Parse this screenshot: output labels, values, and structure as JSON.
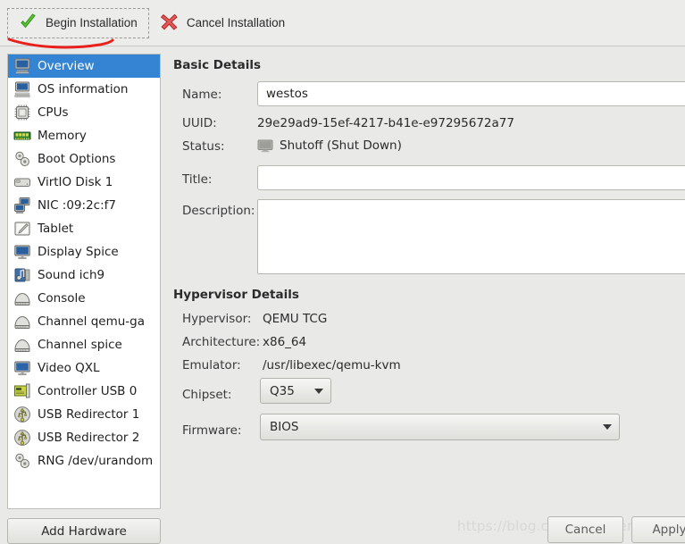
{
  "window": {
    "background_color": "#e9e9e7",
    "accent_color": "#3584d4"
  },
  "toolbar": {
    "begin_label": "Begin Installation",
    "begin_icon": "green-check-icon",
    "cancel_label": "Cancel Installation",
    "cancel_icon": "red-x-icon"
  },
  "sidebar": {
    "items": [
      {
        "label": "Overview",
        "icon": "monitor-icon",
        "selected": true
      },
      {
        "label": "OS information",
        "icon": "computer-icon",
        "selected": false
      },
      {
        "label": "CPUs",
        "icon": "cpu-chip-icon",
        "selected": false
      },
      {
        "label": "Memory",
        "icon": "memory-ram-icon",
        "selected": false
      },
      {
        "label": "Boot Options",
        "icon": "gears-icon",
        "selected": false
      },
      {
        "label": "VirtIO Disk 1",
        "icon": "hard-disk-icon",
        "selected": false
      },
      {
        "label": "NIC :09:2c:f7",
        "icon": "network-card-icon",
        "selected": false
      },
      {
        "label": "Tablet",
        "icon": "tablet-pen-icon",
        "selected": false
      },
      {
        "label": "Display Spice",
        "icon": "display-icon",
        "selected": false
      },
      {
        "label": "Sound ich9",
        "icon": "sound-icon",
        "selected": false
      },
      {
        "label": "Console",
        "icon": "console-icon",
        "selected": false
      },
      {
        "label": "Channel qemu-ga",
        "icon": "console-icon",
        "selected": false
      },
      {
        "label": "Channel spice",
        "icon": "console-icon",
        "selected": false
      },
      {
        "label": "Video QXL",
        "icon": "video-icon",
        "selected": false
      },
      {
        "label": "Controller USB 0",
        "icon": "controller-icon",
        "selected": false
      },
      {
        "label": "USB Redirector 1",
        "icon": "usb-icon",
        "selected": false
      },
      {
        "label": "USB Redirector 2",
        "icon": "usb-icon",
        "selected": false
      },
      {
        "label": "RNG /dev/urandom",
        "icon": "gears-icon",
        "selected": false
      }
    ],
    "add_hardware_label": "Add Hardware"
  },
  "basic_details": {
    "title": "Basic Details",
    "name_label": "Name:",
    "name_value": "westos",
    "name_placeholder": "",
    "uuid_label": "UUID:",
    "uuid_value": "29e29ad9-15ef-4217-b41e-e97295672a77",
    "status_label": "Status:",
    "status_value": "Shutoff (Shut Down)",
    "status_icon": "shutoff-monitor-icon",
    "title_label": "Title:",
    "title_value": "",
    "title_placeholder": "",
    "description_label": "Description:",
    "description_value": "",
    "description_placeholder": ""
  },
  "hypervisor_details": {
    "title": "Hypervisor Details",
    "hypervisor_label": "Hypervisor:",
    "hypervisor_value": "QEMU TCG",
    "architecture_label": "Architecture:",
    "architecture_value": "x86_64",
    "emulator_label": "Emulator:",
    "emulator_value": "/usr/libexec/qemu-kvm",
    "chipset_label": "Chipset:",
    "chipset_value": "Q35",
    "firmware_label": "Firmware:",
    "firmware_value": "BIOS"
  },
  "footer": {
    "cancel_label": "Cancel",
    "apply_label": "Apply"
  },
  "watermark": {
    "text": "https://blog.csdn.net/thermal_life"
  },
  "annotation": {
    "type": "red-underline",
    "color": "#e8211c"
  }
}
